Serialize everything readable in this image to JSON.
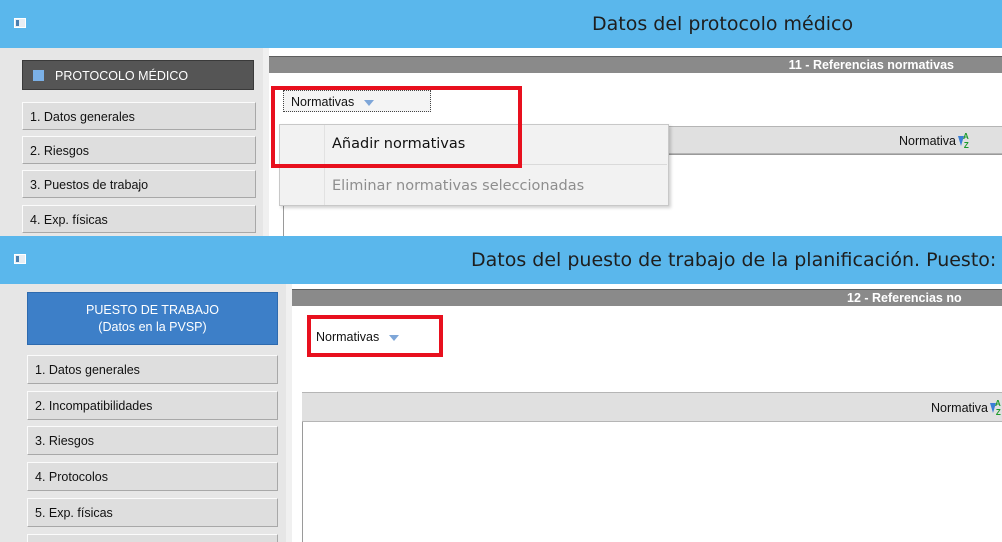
{
  "window_top": {
    "title": "Datos del protocolo médico",
    "sidebar": {
      "header": "PROTOCOLO MÉDICO",
      "items": [
        "1. Datos generales",
        "2. Riesgos",
        "3. Puestos de trabajo",
        "4. Exp. físicas"
      ]
    },
    "section_header": "11 - Referencias normativas",
    "toolbar_button": "Normativas",
    "grid_column": "Normativa",
    "dropdown_menu": {
      "items": [
        {
          "label": "Añadir normativas",
          "enabled": true
        },
        {
          "label": "Eliminar normativas seleccionadas",
          "enabled": false
        }
      ]
    }
  },
  "window_bottom": {
    "title": "Datos del puesto de trabajo de la planificación.  Puesto:",
    "sidebar": {
      "header_line1": "PUESTO DE TRABAJO",
      "header_line2": "(Datos en la PVSP)",
      "items": [
        "1. Datos generales",
        "2. Incompatibilidades",
        "3. Riesgos",
        "4. Protocolos",
        "5. Exp. físicas"
      ]
    },
    "section_header": "12 - Referencias no",
    "toolbar_button": "Normativas",
    "grid_column": "Normativa"
  },
  "colors": {
    "titlebar": "#5ab7ec",
    "highlight": "#e8101e",
    "sidebar_header_dark": "#555555",
    "sidebar_header_blue": "#3d7fc8",
    "section_header": "#8a8a8a"
  }
}
